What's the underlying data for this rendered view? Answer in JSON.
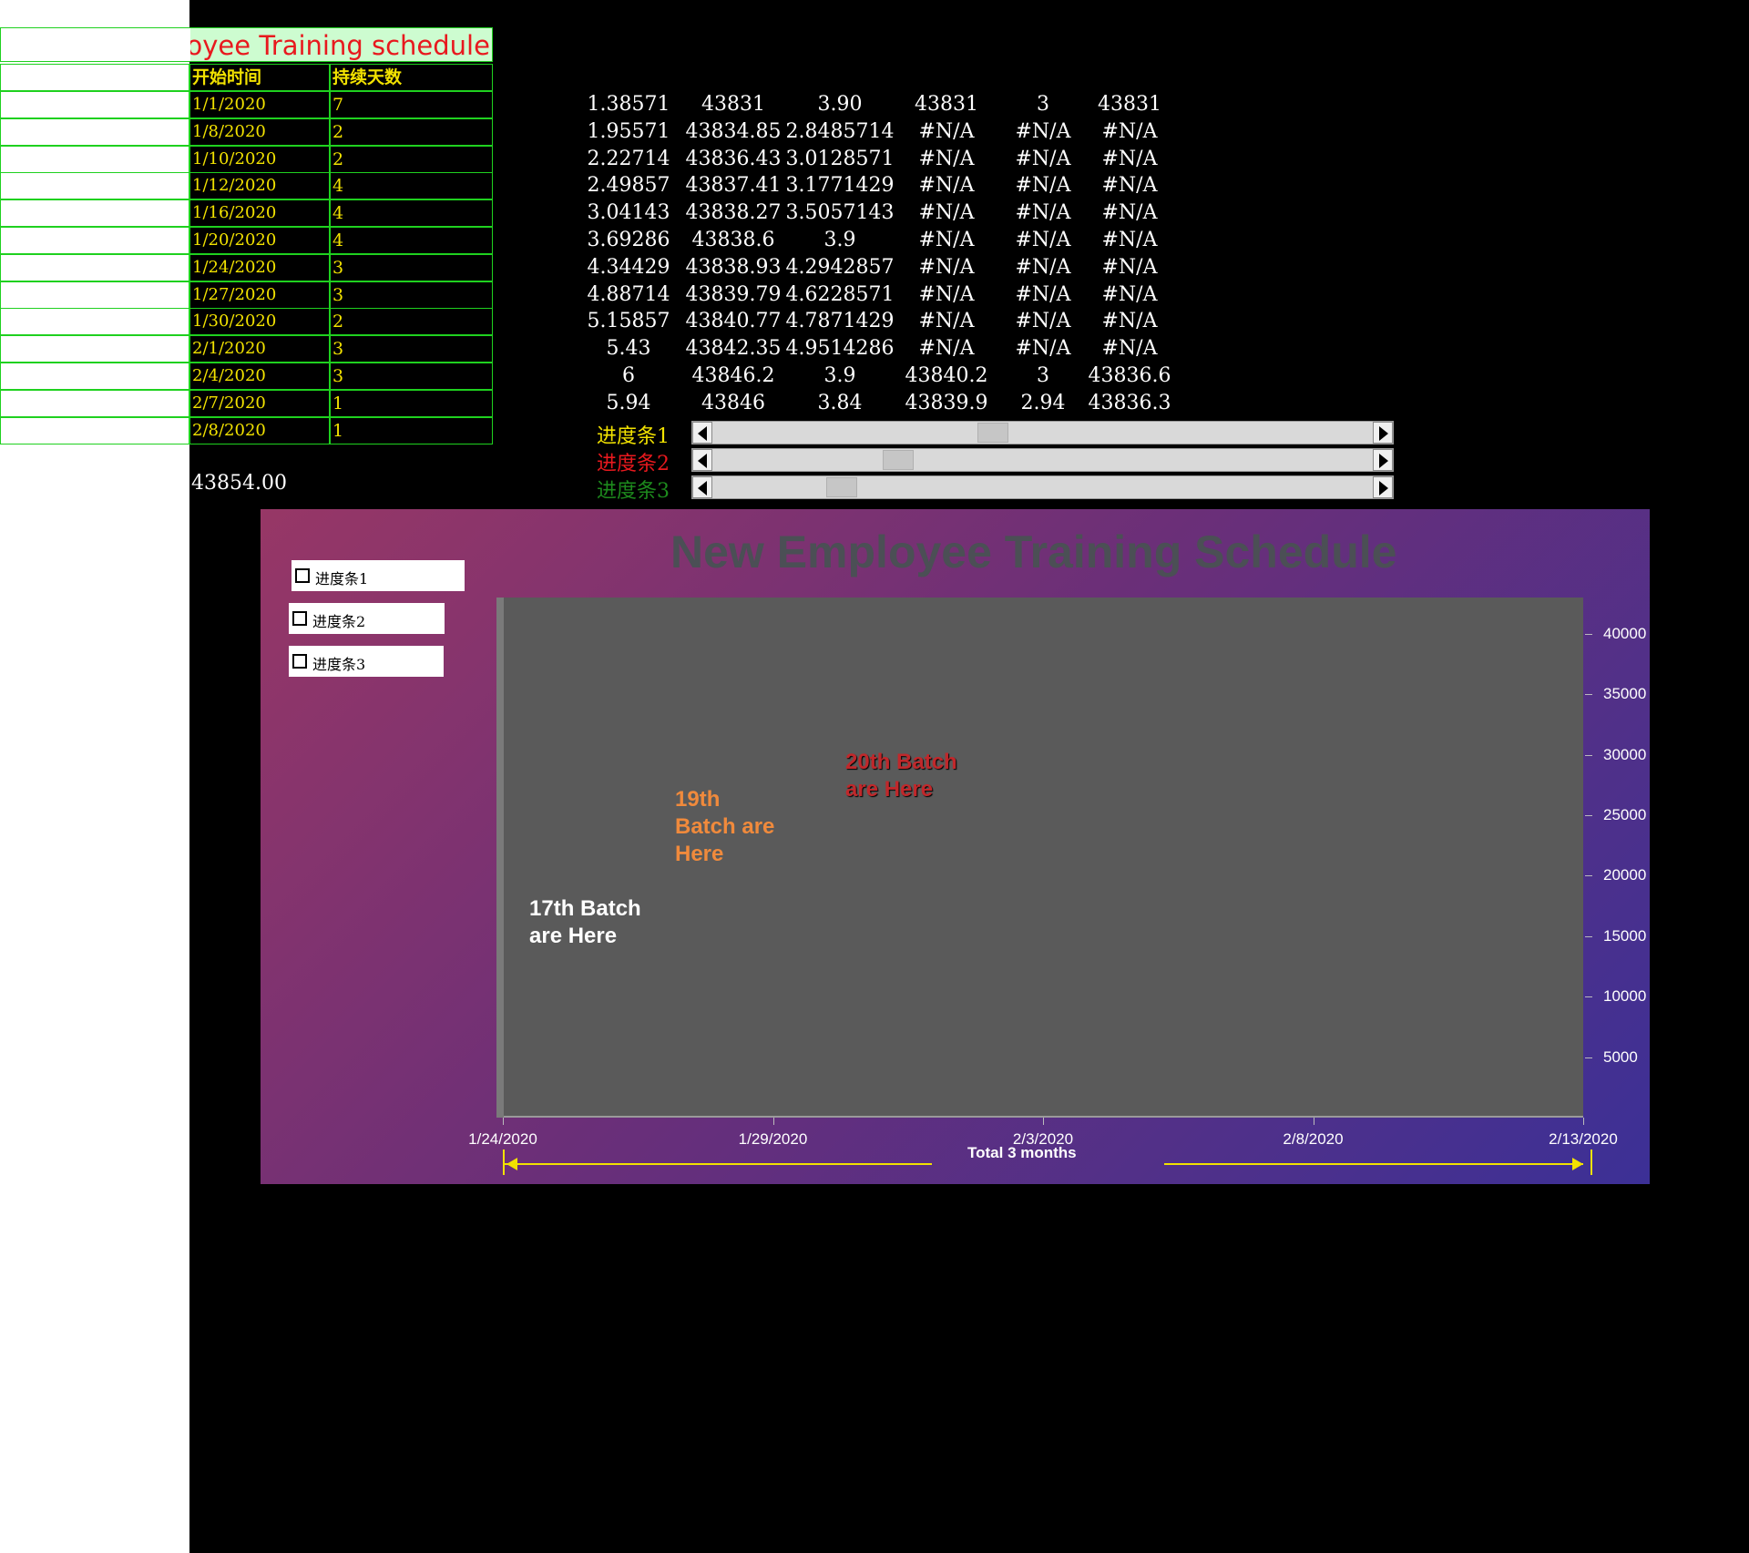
{
  "schedule": {
    "title": "New Employee Training schedule",
    "col_start": "开始时间",
    "col_days": "持续天数",
    "rows": [
      {
        "start": "1/1/2020",
        "days": "7"
      },
      {
        "start": "1/8/2020",
        "days": "2"
      },
      {
        "start": "1/10/2020",
        "days": "2"
      },
      {
        "start": "1/12/2020",
        "days": "4"
      },
      {
        "start": "1/16/2020",
        "days": "4"
      },
      {
        "start": "1/20/2020",
        "days": "4"
      },
      {
        "start": "1/24/2020",
        "days": "3"
      },
      {
        "start": "1/27/2020",
        "days": "3"
      },
      {
        "start": "1/30/2020",
        "days": "2"
      },
      {
        "start": "2/1/2020",
        "days": "3"
      },
      {
        "start": "2/4/2020",
        "days": "3"
      },
      {
        "start": "2/7/2020",
        "days": "1"
      },
      {
        "start": "2/8/2020",
        "days": "1"
      }
    ],
    "total_value": "43854.00"
  },
  "calc_table": [
    [
      "1.38571",
      "43831",
      "3.90",
      "43831",
      "3",
      "43831"
    ],
    [
      "1.95571",
      "43834.85",
      "2.8485714",
      "#N/A",
      "#N/A",
      "#N/A"
    ],
    [
      "2.22714",
      "43836.43",
      "3.0128571",
      "#N/A",
      "#N/A",
      "#N/A"
    ],
    [
      "2.49857",
      "43837.41",
      "3.1771429",
      "#N/A",
      "#N/A",
      "#N/A"
    ],
    [
      "3.04143",
      "43838.27",
      "3.5057143",
      "#N/A",
      "#N/A",
      "#N/A"
    ],
    [
      "3.69286",
      "43838.6",
      "3.9",
      "#N/A",
      "#N/A",
      "#N/A"
    ],
    [
      "4.34429",
      "43838.93",
      "4.2942857",
      "#N/A",
      "#N/A",
      "#N/A"
    ],
    [
      "4.88714",
      "43839.79",
      "4.6228571",
      "#N/A",
      "#N/A",
      "#N/A"
    ],
    [
      "5.15857",
      "43840.77",
      "4.7871429",
      "#N/A",
      "#N/A",
      "#N/A"
    ],
    [
      "5.43",
      "43842.35",
      "4.9514286",
      "#N/A",
      "#N/A",
      "#N/A"
    ],
    [
      "6",
      "43846.2",
      "3.9",
      "43840.2",
      "3",
      "43836.6"
    ],
    [
      "5.94",
      "43846",
      "3.84",
      "43839.9",
      "2.94",
      "43836.3"
    ]
  ],
  "sliders": [
    {
      "label": "进度条1",
      "color": "#f2e200",
      "position": 0.42
    },
    {
      "label": "进度条2",
      "color": "#e8191e",
      "position": 0.27
    },
    {
      "label": "进度条3",
      "color": "#1d8a1d",
      "position": 0.18
    }
  ],
  "chart": {
    "title": "New Employee Training Schedule",
    "checkboxes": [
      "进度条1",
      "进度条2",
      "进度条3"
    ],
    "y_ticks": [
      "40000",
      "35000",
      "30000",
      "25000",
      "20000",
      "15000",
      "10000",
      "5000"
    ],
    "x_ticks": [
      "1/24/2020",
      "1/29/2020",
      "2/3/2020",
      "2/8/2020",
      "2/13/2020"
    ],
    "annotations": [
      {
        "text": "17th Batch\nare Here",
        "color": "#ffffff"
      },
      {
        "text": "19th\nBatch are\nHere",
        "color": "#f08a3c"
      },
      {
        "text": "20th Batch\nare Here",
        "color": "#c0282b"
      }
    ],
    "total_label": "Total 3 months"
  },
  "chart_data": {
    "type": "bar",
    "title": "New Employee Training Schedule",
    "categories": [
      "1/24/2020",
      "1/29/2020",
      "2/3/2020",
      "2/8/2020",
      "2/13/2020"
    ],
    "ylim": [
      0,
      43000
    ],
    "grid": false,
    "legend": "none"
  }
}
